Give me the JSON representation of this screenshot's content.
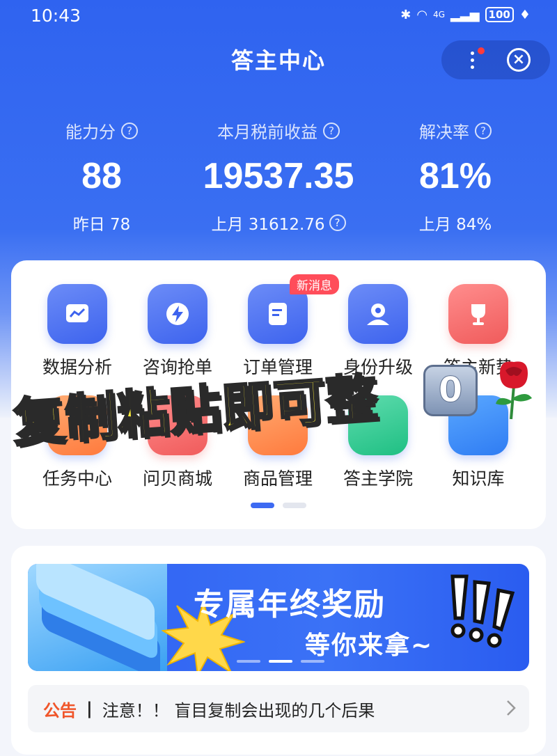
{
  "status_bar": {
    "time": "10:43",
    "network": "4G",
    "battery": "100"
  },
  "header": {
    "title": "答主中心"
  },
  "stats": [
    {
      "label": "能力分",
      "value": "88",
      "sub": "昨日 78"
    },
    {
      "label": "本月税前收益",
      "value": "19537.35",
      "sub": "上月 31612.76"
    },
    {
      "label": "解决率",
      "value": "81%",
      "sub": "上月 84%"
    }
  ],
  "features": {
    "row1": [
      {
        "label": "数据分析",
        "icon": "chart-icon"
      },
      {
        "label": "咨询抢单",
        "icon": "lightning-icon"
      },
      {
        "label": "订单管理",
        "icon": "document-icon",
        "badge": "新消息"
      },
      {
        "label": "身份升级",
        "icon": "user-icon"
      },
      {
        "label": "答主新势",
        "icon": "trophy-icon"
      }
    ],
    "row2": [
      {
        "label": "任务中心",
        "icon": "task-icon"
      },
      {
        "label": "问贝商城",
        "icon": "shop-icon"
      },
      {
        "label": "商品管理",
        "icon": "goods-icon"
      },
      {
        "label": "答主学院",
        "icon": "school-icon"
      },
      {
        "label": "知识库",
        "icon": "book-icon"
      }
    ]
  },
  "overlay": {
    "text": "复制粘贴即可整",
    "key": "0"
  },
  "banner": {
    "title": "专属年终奖励",
    "subtitle": "等你来拿~"
  },
  "notice": {
    "tag": "公告",
    "separator": "|",
    "text": "注意！！ 盲目复制会出现的几个后果"
  },
  "colors": {
    "primary": "#2f63f0",
    "accent_red": "#ff4d5a",
    "notice_orange": "#f0552a"
  }
}
